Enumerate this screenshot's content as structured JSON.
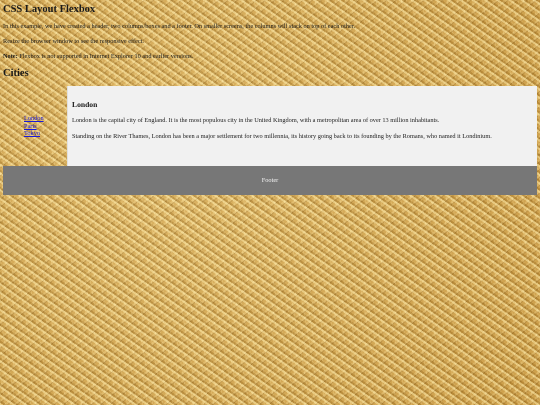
{
  "header": {
    "title": "CSS Layout Flexbox",
    "intro": "In this example, we have created a header, two columns/boxes and a footer. On smaller screens, the columns will stack on top of each other.",
    "resize_hint": "Resize the browser window to see the responsive effect.",
    "note_label": "Note:",
    "note_text": " Flexbox is not supported in Internet Explorer 10 and earlier versions."
  },
  "section": {
    "heading": "Cities"
  },
  "menu": {
    "items": [
      {
        "label": "London"
      },
      {
        "label": "Paris"
      },
      {
        "label": "Tokyo"
      }
    ],
    "link_color": "#1a1ad8"
  },
  "content": {
    "heading": "London",
    "paragraphs": [
      "London is the capital city of England. It is the most populous city in the United Kingdom, with a metropolitan area of over 13 million inhabitants.",
      "Standing on the River Thames, London has been a major settlement for two millennia, its history going back to its founding by the Romans, who named it Londinium."
    ],
    "background": "#f1f1f1"
  },
  "footer": {
    "text": "Footer",
    "background": "#777777"
  }
}
